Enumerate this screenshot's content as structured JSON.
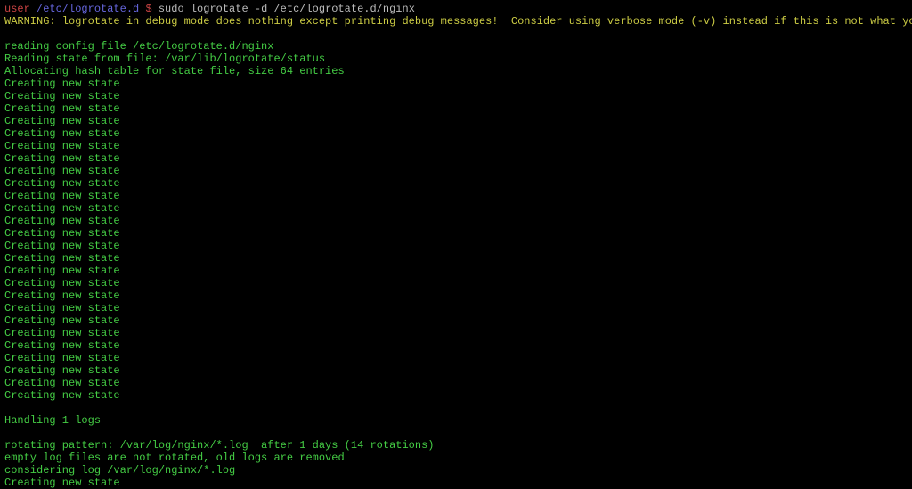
{
  "prompt": {
    "user": "user",
    "cwd": "/etc/logrotate.d",
    "symbol": "$",
    "command": "sudo logrotate -d /etc/logrotate.d/nginx"
  },
  "warning": "WARNING: logrotate in debug mode does nothing except printing debug messages!  Consider using verbose mode (-v) instead if this is not what you want.",
  "header_lines": [
    "reading config file /etc/logrotate.d/nginx",
    "Reading state from file: /var/lib/logrotate/status",
    "Allocating hash table for state file, size 64 entries"
  ],
  "creating_state_line": "Creating new state",
  "creating_state_count": 26,
  "tail_lines": [
    "Handling 1 logs",
    "",
    "rotating pattern: /var/log/nginx/*.log  after 1 days (14 rotations)",
    "empty log files are not rotated, old logs are removed",
    "considering log /var/log/nginx/*.log",
    "Creating new state"
  ]
}
